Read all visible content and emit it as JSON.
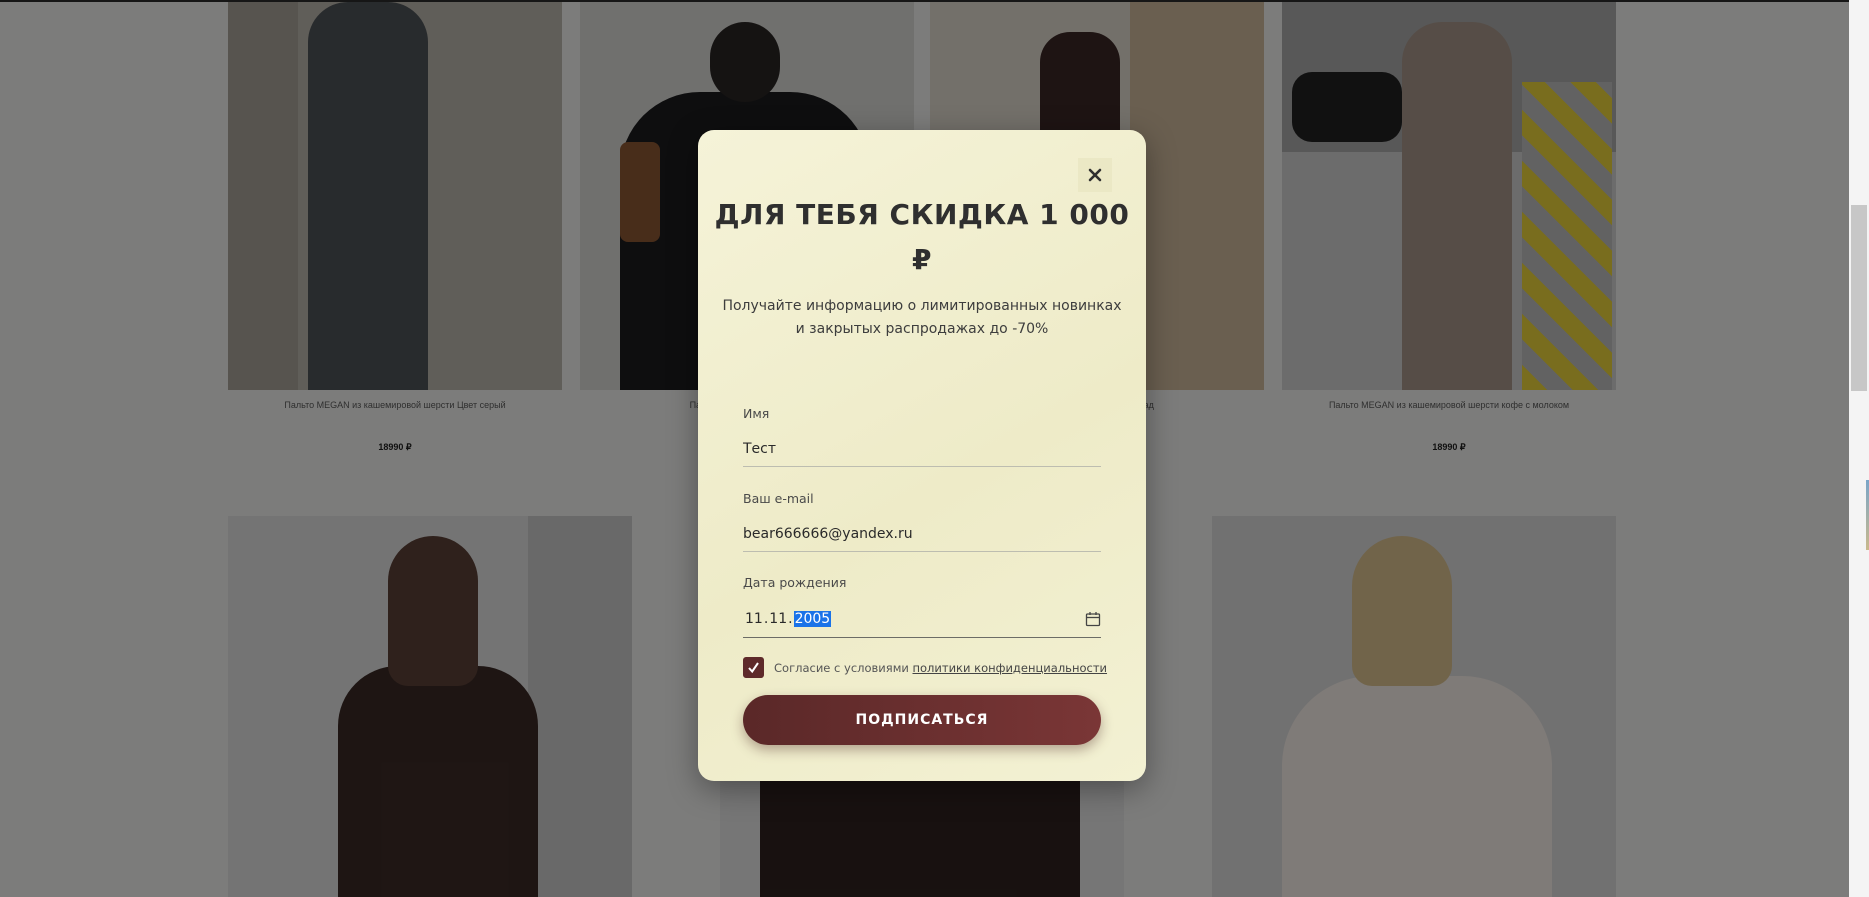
{
  "products": [
    {
      "caption": "Пальто MEGAN из кашемировой шерсти Цвет серый",
      "price": "18990 ₽"
    },
    {
      "caption": "Пальто с поясом из шерсти",
      "price": ""
    },
    {
      "caption": "Пальто из шерсти шоколад",
      "price": ""
    },
    {
      "caption": "Пальто MEGAN из кашемировой шерсти кофе с молоком",
      "price": "18990 ₽"
    }
  ],
  "modal": {
    "close_icon": "×",
    "title": "ДЛЯ ТЕБЯ СКИДКА 1 000 ₽",
    "subtitle": "Получайте информацию о лимитированных новинках и закрытых распродажах до -70%",
    "name_label": "Имя",
    "name_value": "Тест",
    "email_label": "Ваш e-mail",
    "email_value": "bear666666@yandex.ru",
    "birth_label": "Дата рождения",
    "birth_day": "11",
    "birth_month": "11",
    "birth_year": "2005",
    "consent_text": "Согласие с условиями ",
    "consent_link": "политики конфиденциальности",
    "consent_checked": true,
    "submit_label": "ПОДПИСАТЬСЯ",
    "accent_color": "#5e2a2a",
    "background_color": "#f3f1d3"
  }
}
